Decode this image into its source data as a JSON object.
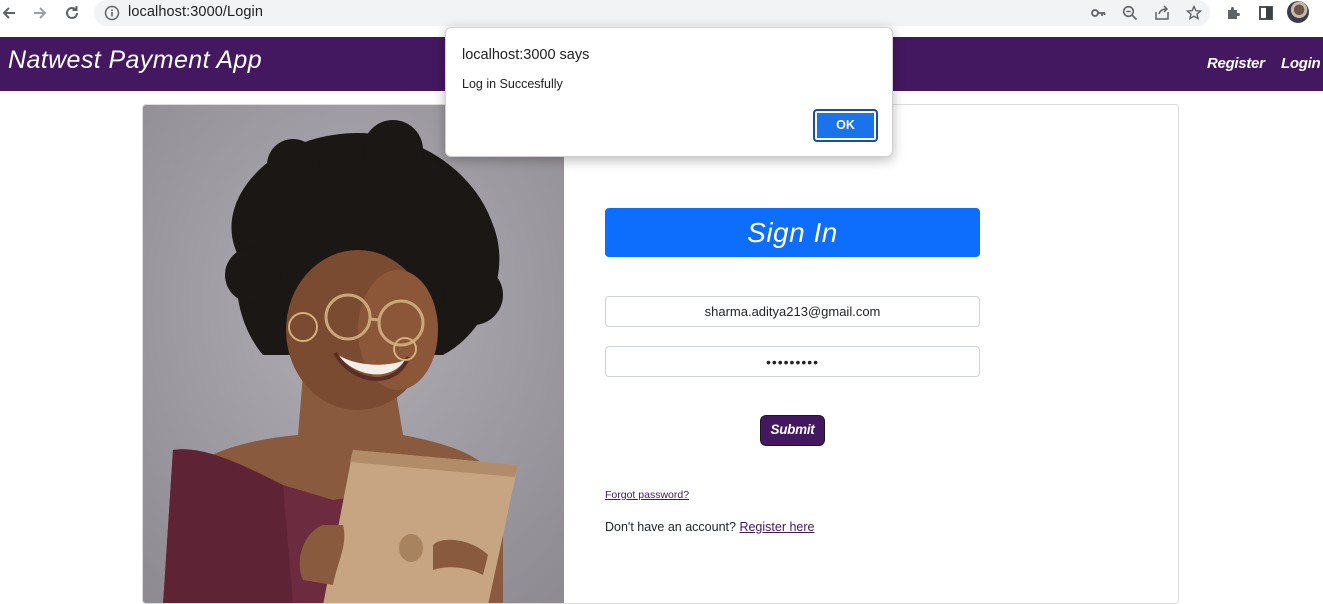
{
  "browser": {
    "url": "localhost:3000/Login",
    "icons": [
      "back-icon",
      "forward-icon",
      "reload-icon",
      "info-icon",
      "key-icon",
      "zoom-icon",
      "share-icon",
      "star-icon",
      "extensions-icon",
      "sidebar-icon",
      "profile-avatar"
    ]
  },
  "navbar": {
    "brand": "Natwest Payment App",
    "links": [
      "Register",
      "Login"
    ],
    "color": "#441860"
  },
  "login_form": {
    "banner": "Sign In",
    "banner_color": "#0d6efd",
    "email_value": "sharma.aditya213@gmail.com",
    "password_value": "•••••••••",
    "submit_label": "Submit",
    "forgot_label": "Forgot password?",
    "no_account_text": "Don't have an account?",
    "register_link": "Register here"
  },
  "alert_dialog": {
    "title": "localhost:3000 says",
    "message": "Log in Succesfully",
    "ok_label": "OK"
  }
}
